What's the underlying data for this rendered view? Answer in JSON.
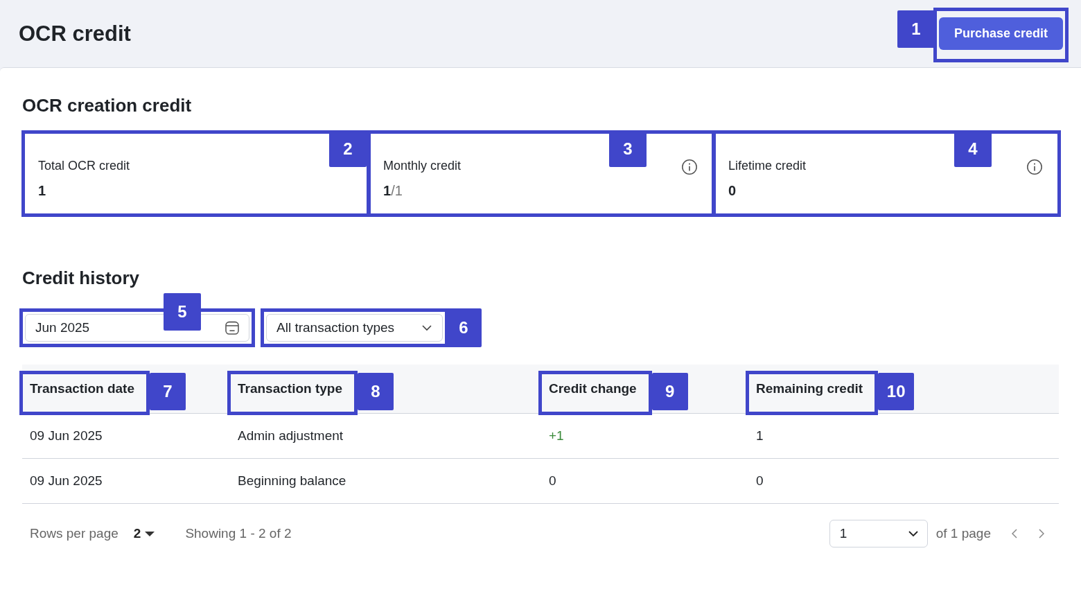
{
  "header": {
    "title": "OCR credit",
    "button": {
      "label": "Purchase credit",
      "marker": "1"
    }
  },
  "summary": {
    "title": "OCR creation credit",
    "cards": [
      {
        "label": "Total OCR credit",
        "value": "1",
        "marker": "2"
      },
      {
        "label": "Monthly credit",
        "value": "1",
        "suffix": "/1",
        "info": true,
        "marker": "3"
      },
      {
        "label": "Lifetime credit",
        "value": "0",
        "info": true,
        "marker": "4"
      }
    ]
  },
  "history": {
    "title": "Credit history",
    "date_filter": {
      "value": "Jun 2025",
      "marker": "5"
    },
    "type_filter": {
      "value": "All transaction types",
      "marker": "6"
    },
    "columns": [
      {
        "label": "Transaction date",
        "marker": "7"
      },
      {
        "label": "Transaction type",
        "marker": "8"
      },
      {
        "label": "Credit change",
        "marker": "9"
      },
      {
        "label": "Remaining credit",
        "marker": "10"
      }
    ],
    "rows": [
      {
        "date": "09 Jun 2025",
        "type": "Admin adjustment",
        "change": "+1",
        "color": "#3a8a3a",
        "remaining": "1"
      },
      {
        "date": "09 Jun 2025",
        "type": "Beginning balance",
        "change": "0",
        "color": "#1f2328",
        "remaining": "0"
      }
    ],
    "footer": {
      "rows_label": "Rows per page",
      "rows_value": "2",
      "showing": "Showing 1 - 2 of 2",
      "page_value": "1",
      "page_total": "of 1 page"
    }
  }
}
